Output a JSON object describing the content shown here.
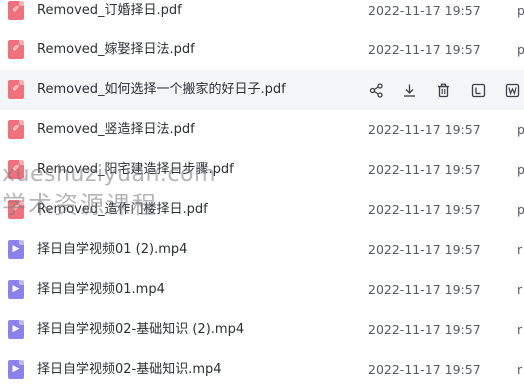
{
  "files": [
    {
      "name": "Removed_订婚择日.pdf",
      "date": "2022-11-17 19:57",
      "type": "p",
      "kind": "pdf",
      "icon": "pdf-file-icon"
    },
    {
      "name": "Removed_嫁娶择日法.pdf",
      "date": "2022-11-17 19:57",
      "type": "p",
      "kind": "pdf",
      "icon": "pdf-file-icon"
    },
    {
      "name": "Removed_如何选择一个搬家的好日子.pdf",
      "date": "",
      "type": "",
      "kind": "pdf",
      "icon": "pdf-file-icon",
      "hovered": true
    },
    {
      "name": "Removed_竖造择日法.pdf",
      "date": "2022-11-17 19:57",
      "type": "p",
      "kind": "pdf",
      "icon": "pdf-file-icon"
    },
    {
      "name": "Removed_阳宅建造择日步骤.pdf",
      "date": "2022-11-17 19:57",
      "type": "p",
      "kind": "pdf",
      "icon": "pdf-file-icon"
    },
    {
      "name": "Removed_造作门楼择日.pdf",
      "date": "2022-11-17 19:57",
      "type": "p",
      "kind": "pdf",
      "icon": "pdf-file-icon"
    },
    {
      "name": "择日自学视频01 (2).mp4",
      "date": "2022-11-17 19:57",
      "type": "r",
      "kind": "mp4",
      "icon": "video-file-icon"
    },
    {
      "name": "择日自学视频01.mp4",
      "date": "2022-11-17 19:57",
      "type": "r",
      "kind": "mp4",
      "icon": "video-file-icon"
    },
    {
      "name": "择日自学视频02-基础知识 (2).mp4",
      "date": "2022-11-17 19:57",
      "type": "r",
      "kind": "mp4",
      "icon": "video-file-icon"
    },
    {
      "name": "择日自学视频02-基础知识.mp4",
      "date": "2022-11-17 19:57",
      "type": "r",
      "kind": "mp4",
      "icon": "video-file-icon"
    }
  ],
  "row_actions": [
    "share-icon",
    "download-icon",
    "delete-icon",
    "text-extract-icon",
    "word-convert-icon"
  ],
  "watermark": {
    "line1": "xueshuziyuan.com",
    "line2": "学术资源课程"
  },
  "colors": {
    "pdf": "#f0717b",
    "mp4": "#8a83ee",
    "hover_row": "#f5f6f8"
  }
}
